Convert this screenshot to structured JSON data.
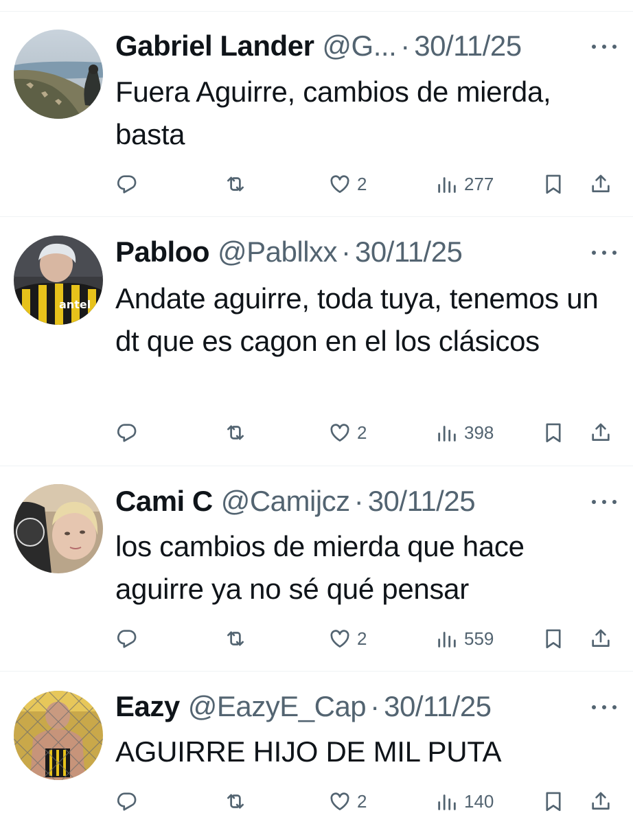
{
  "tweets": [
    {
      "display_name": "Gabriel Lander",
      "handle": "@G...",
      "dot": "·",
      "date": "30/11/25",
      "text": "Fuera Aguirre, cambios de mierda, basta",
      "replies": "",
      "retweets": "",
      "likes": "2",
      "views": "277",
      "avatar_icon": "avatar-coastal-city-photo"
    },
    {
      "display_name": "Pabloo",
      "handle": "@Pabllxx",
      "dot": "·",
      "date": "30/11/25",
      "text": "Andate aguirre, toda tuya, tenemos un dt que es cagon en el los clásicos",
      "replies": "",
      "retweets": "",
      "likes": "2",
      "views": "398",
      "avatar_icon": "avatar-person-striped-jersey",
      "avatar_text": "antel"
    },
    {
      "display_name": "Cami C",
      "handle": "@Camijcz",
      "dot": "·",
      "date": "30/11/25",
      "text": "los cambios de mierda que hace aguirre ya no sé qué pensar",
      "replies": "",
      "retweets": "",
      "likes": "2",
      "views": "559",
      "avatar_icon": "avatar-person-selfie"
    },
    {
      "display_name": "Eazy",
      "handle": "@EazyE_Cap",
      "dot": "·",
      "date": "30/11/25",
      "text": "AGUIRRE HIJO DE MIL PUTA",
      "replies": "",
      "retweets": "",
      "likes": "2",
      "views": "140",
      "avatar_icon": "avatar-person-behind-fence"
    }
  ],
  "icons": {
    "reply": "reply-icon",
    "retweet": "retweet-icon",
    "like": "heart-icon",
    "views": "views-icon",
    "bookmark": "bookmark-icon",
    "share": "share-icon",
    "more": "more-icon"
  },
  "colors": {
    "text_primary": "#0f1419",
    "text_secondary": "#536471",
    "divider": "#eff3f4",
    "background": "#ffffff"
  }
}
